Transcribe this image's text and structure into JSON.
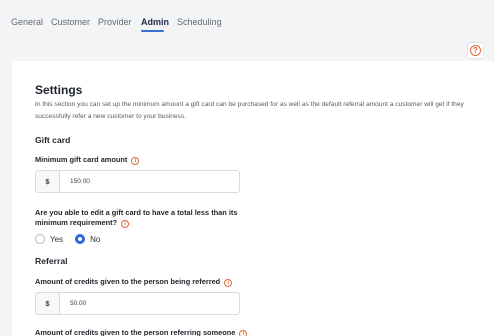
{
  "tabs": [
    {
      "label": "General"
    },
    {
      "label": "Customer"
    },
    {
      "label": "Provider"
    },
    {
      "label": "Admin"
    },
    {
      "label": "Scheduling"
    }
  ],
  "active_tab": "Admin",
  "help_icon": "question-circle-icon",
  "settings": {
    "title": "Settings",
    "description": "In this section you can set up the minimum amount a gift card can be purchased for as well as the default referral amount a customer will get if they successfully refer a new customer to your business."
  },
  "gift_card": {
    "heading": "Gift card",
    "min_label": "Minimum gift card amount",
    "currency": "$",
    "min_value": "150.00",
    "edit_question_line1": "Are you able to edit a gift card to have a total less than its",
    "edit_question_line2": "minimum requirement?",
    "options": [
      {
        "label": "Yes",
        "checked": false
      },
      {
        "label": "No",
        "checked": true
      }
    ]
  },
  "referral": {
    "heading": "Referral",
    "referred_label": "Amount of credits given to the person being referred",
    "currency": "$",
    "referred_value": "50.00",
    "referring_label": "Amount of credits given to the person referring someone"
  },
  "colors": {
    "accent": "#2f66d9",
    "info": "#e0683a",
    "background": "#f3f4f6"
  }
}
